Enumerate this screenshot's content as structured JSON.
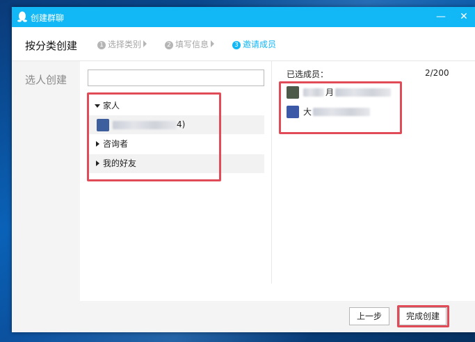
{
  "window": {
    "title": "创建群聊"
  },
  "header": {
    "title": "按分类创建",
    "steps": [
      {
        "num": "1",
        "label": "选择类别"
      },
      {
        "num": "2",
        "label": "填写信息"
      },
      {
        "num": "3",
        "label": "邀请成员"
      }
    ]
  },
  "sidebar": {
    "items": [
      {
        "label": "选人创建"
      }
    ]
  },
  "search": {
    "value": "",
    "placeholder": ""
  },
  "tree": {
    "groups": [
      {
        "label": "家人",
        "expanded": true,
        "members": [
          {
            "name_suffix": "4)"
          }
        ]
      },
      {
        "label": "咨询者",
        "expanded": false
      },
      {
        "label": "我的好友",
        "expanded": false
      }
    ]
  },
  "selected": {
    "title": "已选成员：",
    "count": "2/200",
    "members": [
      {
        "name_visible": "月"
      },
      {
        "name_visible": "大"
      }
    ]
  },
  "buttons": {
    "prev": "上一步",
    "done": "完成创建"
  },
  "colors": {
    "accent": "#12b7f5",
    "highlight": "#e04b57"
  },
  "icons": {
    "title": "qq-penguin-icon",
    "minimize": "minimize-icon",
    "close": "close-icon"
  }
}
